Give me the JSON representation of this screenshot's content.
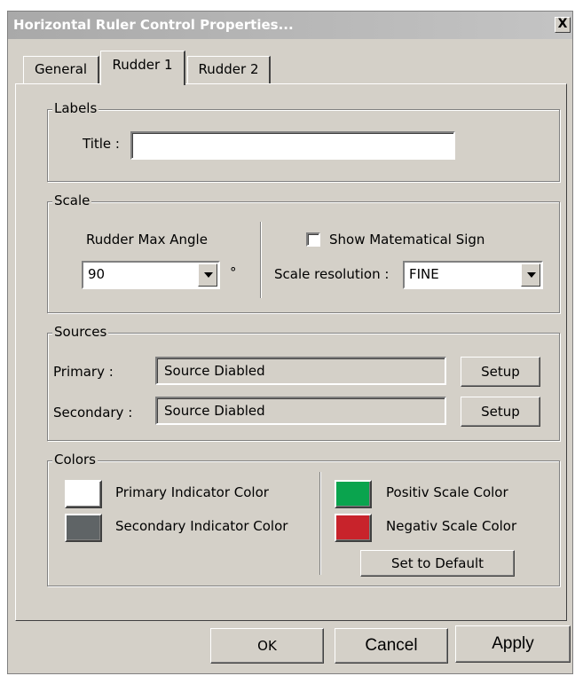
{
  "window": {
    "title": "Horizontal Ruler Control Properties...",
    "close_glyph": "X"
  },
  "tabs": [
    {
      "label": "General",
      "active": false
    },
    {
      "label": "Rudder 1",
      "active": true
    },
    {
      "label": "Rudder 2",
      "active": false
    }
  ],
  "labels_group": {
    "legend": "Labels",
    "title_label": "Title :",
    "title_value": ""
  },
  "scale_group": {
    "legend": "Scale",
    "max_angle_label": "Rudder Max Angle",
    "max_angle_value": "90",
    "degree_symbol": "°",
    "show_sign_label": "Show Matematical Sign",
    "show_sign_checked": false,
    "resolution_label": "Scale resolution :",
    "resolution_value": "FINE"
  },
  "sources_group": {
    "legend": "Sources",
    "primary_label": "Primary :",
    "primary_value": "Source Diabled",
    "secondary_label": "Secondary :",
    "secondary_value": "Source Diabled",
    "setup_label": "Setup"
  },
  "colors_group": {
    "legend": "Colors",
    "primary_indicator_label": "Primary Indicator Color",
    "primary_indicator_color": "#ffffff",
    "secondary_indicator_label": "Secondary Indicator Color",
    "secondary_indicator_color": "#5f6466",
    "positive_label": "Positiv Scale Color",
    "positive_color": "#0aa44e",
    "negative_label": "Negativ Scale Color",
    "negative_color": "#c8232b",
    "default_button": "Set to Default"
  },
  "footer": {
    "ok": "OK",
    "cancel": "Cancel",
    "apply": "Apply"
  }
}
